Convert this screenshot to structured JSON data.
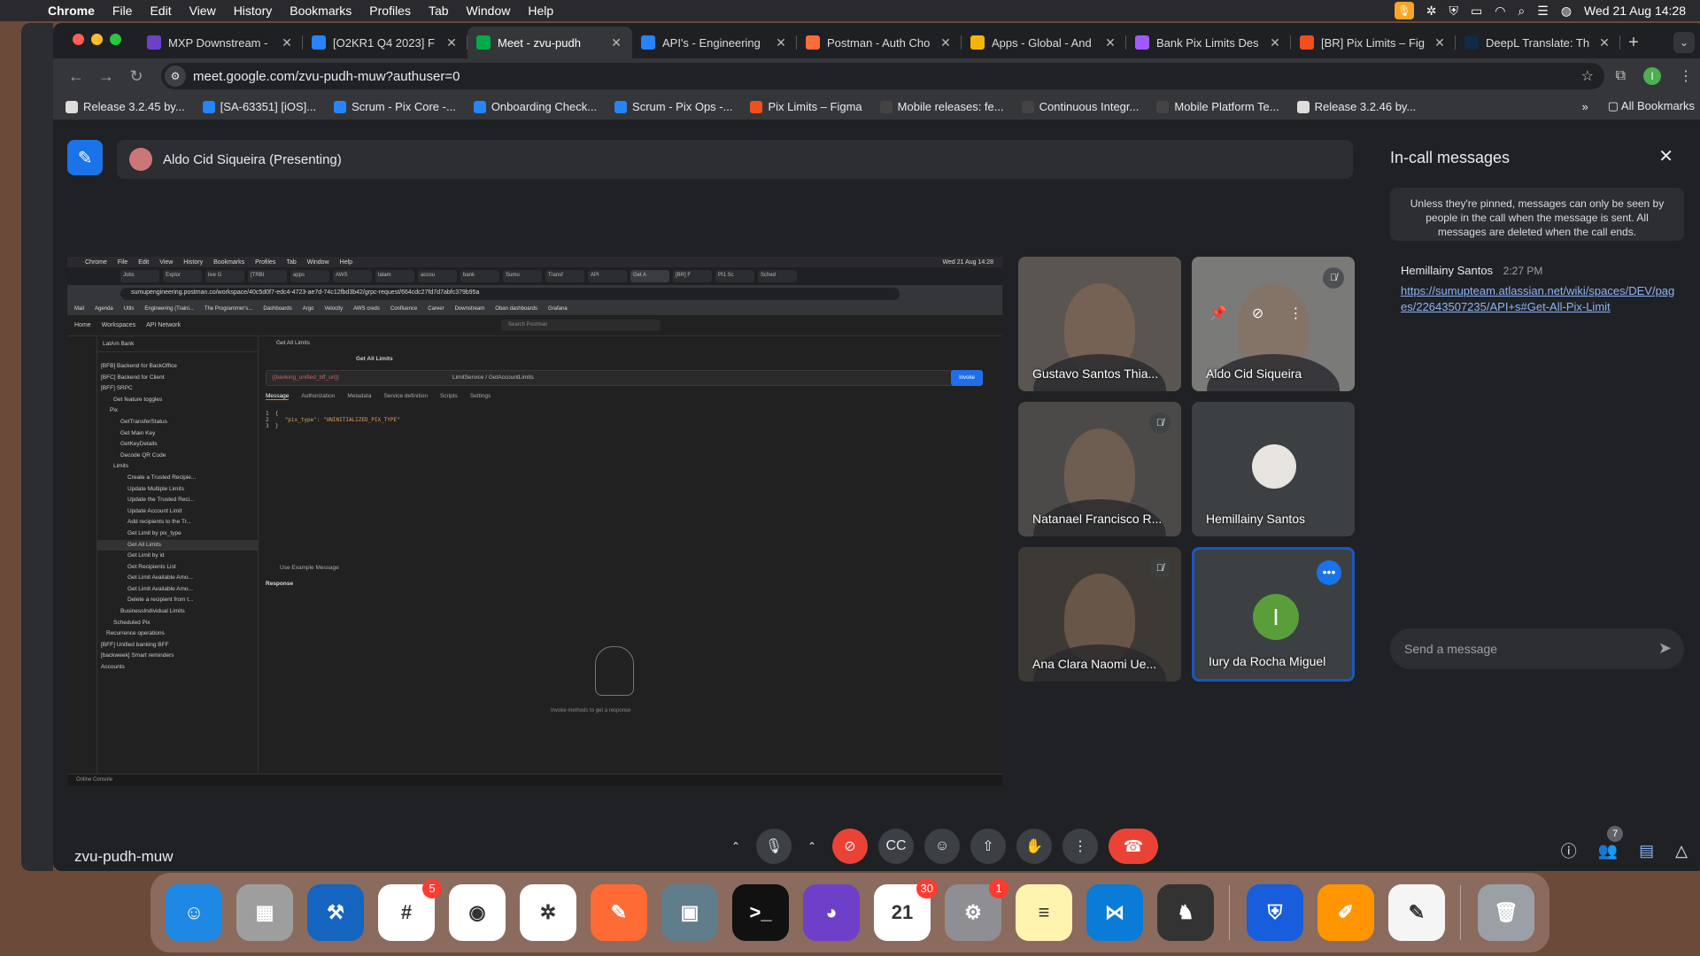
{
  "menubar": {
    "app": "Chrome",
    "items": [
      "File",
      "Edit",
      "View",
      "History",
      "Bookmarks",
      "Profiles",
      "Tab",
      "Window",
      "Help"
    ],
    "datetime": "Wed 21 Aug  14:28"
  },
  "tabs": [
    {
      "title": "MXP Downstream -",
      "color": "#6e40c9"
    },
    {
      "title": "[O2KR1 Q4 2023] F",
      "color": "#2684ff"
    },
    {
      "title": "Meet - zvu-pudh",
      "color": "#00ac47",
      "active": true
    },
    {
      "title": "API's - Engineering",
      "color": "#2684ff"
    },
    {
      "title": "Postman - Auth Cho",
      "color": "#ff6c37"
    },
    {
      "title": "Apps - Global - And",
      "color": "#f4b400"
    },
    {
      "title": "Bank Pix Limits Des",
      "color": "#a259ff"
    },
    {
      "title": "[BR] Pix Limits – Fig",
      "color": "#f24e1e"
    },
    {
      "title": "DeepL Translate: Th",
      "color": "#0f2b46"
    }
  ],
  "address": {
    "url": "meet.google.com/zvu-pudh-muw?authuser=0"
  },
  "bookmarks": [
    {
      "label": "Release 3.2.45 by...",
      "color": "#ddd"
    },
    {
      "label": "[SA-63351] [iOS]...",
      "color": "#2684ff"
    },
    {
      "label": "Scrum - Pix Core -...",
      "color": "#2684ff"
    },
    {
      "label": "Onboarding Check...",
      "color": "#2684ff"
    },
    {
      "label": "Scrum - Pix Ops -...",
      "color": "#2684ff"
    },
    {
      "label": "Pix Limits – Figma",
      "color": "#f24e1e"
    },
    {
      "label": "Mobile releases: fe...",
      "color": "#444"
    },
    {
      "label": "Continuous Integr...",
      "color": "#444"
    },
    {
      "label": "Mobile Platform Te...",
      "color": "#444"
    },
    {
      "label": "Release 3.2.46 by...",
      "color": "#ddd"
    }
  ],
  "bookmarks_right": "All Bookmarks",
  "presenter": {
    "name": "Aldo Cid Siqueira (Presenting)"
  },
  "shared_screen": {
    "menubar": [
      "Chrome",
      "File",
      "Edit",
      "View",
      "History",
      "Bookmarks",
      "Profiles",
      "Tab",
      "Window",
      "Help"
    ],
    "datetime": "Wed 21 Aug 14:28",
    "url": "sumupengineering.postman.co/workspace/40c5d0f7-edc4-4723-ae7d-74c12fbd3b42/grpc-request/664cdc27fd7d7abfc379b95a",
    "bookmarks": [
      "Mail",
      "Agenda",
      "Utils",
      "Engineering (Traini...",
      "The Programmer's...",
      "Dashboards",
      "Argo",
      "Velocity",
      "AWS creds",
      "Confluence",
      "Career",
      "Downstream",
      "Oban dashboards",
      "Grafana"
    ],
    "top_nav": [
      "Home",
      "Workspaces",
      "API Network"
    ],
    "search": "Search Postman",
    "workspace": "LatAm Bank",
    "tree": [
      "[BFB] Backend for BackOffice",
      "[BFC] Backend for Client",
      "[BFF] SRPC",
      "Get feature toggles",
      "Pix",
      "GetTransferStatus",
      "Get Main Key",
      "GetKeyDetails",
      "Decode QR Code",
      "Limits",
      "Create a Trusted Recipie...",
      "Update Multiple Limits",
      "Update the Trusted Reci...",
      "Update Account Limit",
      "Add recipients to the Tr...",
      "Get Limit by pix_type",
      "Get All Limits",
      "Get Limit by id",
      "Get Recipients List",
      "Get Limit Available Amo...",
      "Get Limit Available Amo...",
      "Delete a recipient from t...",
      "BusinessIndividual Limits",
      "Scheduled Pix",
      "Recurrence operations",
      "[BFF] Unified banking BFF",
      "[backweek] Smart reminders",
      "Accounts"
    ],
    "request_tab": "Get All Limits",
    "breadcrumb": "Get All Limits",
    "request_url": "{{banking_unified_bff_url}}",
    "method": "LimitService / GetAccountLimits",
    "invoke": "Invoke",
    "subtabs": [
      "Message",
      "Authorization",
      "Metadata",
      "Service definition",
      "Scripts",
      "Settings"
    ],
    "code_key": "\"pix_type\"",
    "code_val": "\"UNINITIALIZED_PIX_TYPE\"",
    "example": "Use Example Message",
    "response": "Response",
    "response_hint": "Invoke methods to get a response",
    "status": "Online   Console"
  },
  "participants": [
    {
      "name": "Gustavo Santos Thia...",
      "muted": false,
      "bg": "#5a5550"
    },
    {
      "name": "Aldo Cid Siqueira",
      "muted": true,
      "bg": "#7a7a78"
    },
    {
      "name": "Natanael Francisco R...",
      "muted": true,
      "bg": "#4b4a48"
    },
    {
      "name": "Hemillainy Santos",
      "muted": false,
      "bg": "#3c4043"
    },
    {
      "name": "Ana Clara Naomi Ue...",
      "muted": true,
      "bg": "#3d3a35"
    },
    {
      "name": "Iury da Rocha Miguel",
      "muted": false,
      "bg": "#3c4043",
      "initial": "I"
    }
  ],
  "chat": {
    "title": "In-call messages",
    "info": "Unless they're pinned, messages can only be seen by people in the call when the message is sent. All messages are deleted when the call ends.",
    "sender": "Hemillainy Santos",
    "time": "2:27 PM",
    "link": "https://sumupteam.atlassian.net/wiki/spaces/DEV/pages/22643507235/API+s#Get-All-Pix-Limit",
    "input_placeholder": "Send a message"
  },
  "meeting_code": "zvu-pudh-muw",
  "people_count": "7",
  "dock": [
    {
      "name": "Finder",
      "color": "#1e88e5",
      "glyph": "☺"
    },
    {
      "name": "Launchpad",
      "color": "#9e9e9e",
      "glyph": "▦"
    },
    {
      "name": "Xcode",
      "color": "#1565c0",
      "glyph": "⚒"
    },
    {
      "name": "Slack",
      "color": "#ffffff",
      "glyph": "#",
      "badge": "5"
    },
    {
      "name": "Chrome",
      "color": "#ffffff",
      "glyph": "◉"
    },
    {
      "name": "ChatGPT",
      "color": "#ffffff",
      "glyph": "✲"
    },
    {
      "name": "Pencil",
      "color": "#ff6b35",
      "glyph": "✎"
    },
    {
      "name": "Preview",
      "color": "#607d8b",
      "glyph": "▣"
    },
    {
      "name": "Terminal",
      "color": "#111111",
      "glyph": ">_"
    },
    {
      "name": "GitHub Desktop",
      "color": "#6e40c9",
      "glyph": "◕"
    },
    {
      "name": "Calendar",
      "color": "#ffffff",
      "glyph": "21",
      "badge": "30"
    },
    {
      "name": "System Settings",
      "color": "#8e8e93",
      "glyph": "⚙",
      "badge": "1"
    },
    {
      "name": "Notes",
      "color": "#fff3b0",
      "glyph": "≡"
    },
    {
      "name": "VS Code",
      "color": "#0a7bd6",
      "glyph": "⋈"
    },
    {
      "name": "Chess",
      "color": "#333333",
      "glyph": "♞"
    },
    {
      "name": "Bitwarden",
      "color": "#175ddc",
      "glyph": "⛨"
    },
    {
      "name": "Pages",
      "color": "#ff9500",
      "glyph": "✐"
    },
    {
      "name": "TextEdit",
      "color": "#f5f5f5",
      "glyph": "✎"
    },
    {
      "name": "Trash",
      "color": "#9aa0a6",
      "glyph": "🗑"
    }
  ]
}
